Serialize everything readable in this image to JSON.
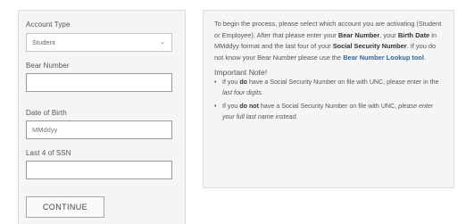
{
  "form": {
    "account_type": {
      "label": "Account Type",
      "value": "Student"
    },
    "bear_number": {
      "label": "Bear Number",
      "value": ""
    },
    "birth_date": {
      "label": "Date of Birth",
      "placeholder": "MMddyy"
    },
    "ssn_last4": {
      "label": "Last 4 of SSN",
      "value": ""
    },
    "continue_label": "CONTINUE"
  },
  "info": {
    "p1": "To begin the process, please select which account you are activating (Student or Employee). After that please enter your ",
    "bear_number_bold": "Bear Number",
    "p2": ", your ",
    "birth_date_bold": "Birth Date",
    "p3": " in MMddyy format and the last four of your ",
    "ssn_bold": "Social Security Number",
    "p4": ". If you do not know your Bear Number please use the ",
    "lookup_link": "Bear Number Lookup tool",
    "p5": ".",
    "important_heading": "Important Note!",
    "bullet1_a": "If you ",
    "bullet1_bold": "do",
    "bullet1_b": " have a Social Security Number on file with UNC, please enter in the ",
    "bullet1_italic": "last four digits",
    "bullet1_c": ".",
    "bullet2_a": "If you ",
    "bullet2_bold": "do not",
    "bullet2_b": " have a Social Security Number on file with UNC, ",
    "bullet2_italic": "please enter your full last name instead",
    "bullet2_c": "."
  },
  "icons": {
    "select_chevron": "chevron-down-icon",
    "bullet": "•"
  }
}
